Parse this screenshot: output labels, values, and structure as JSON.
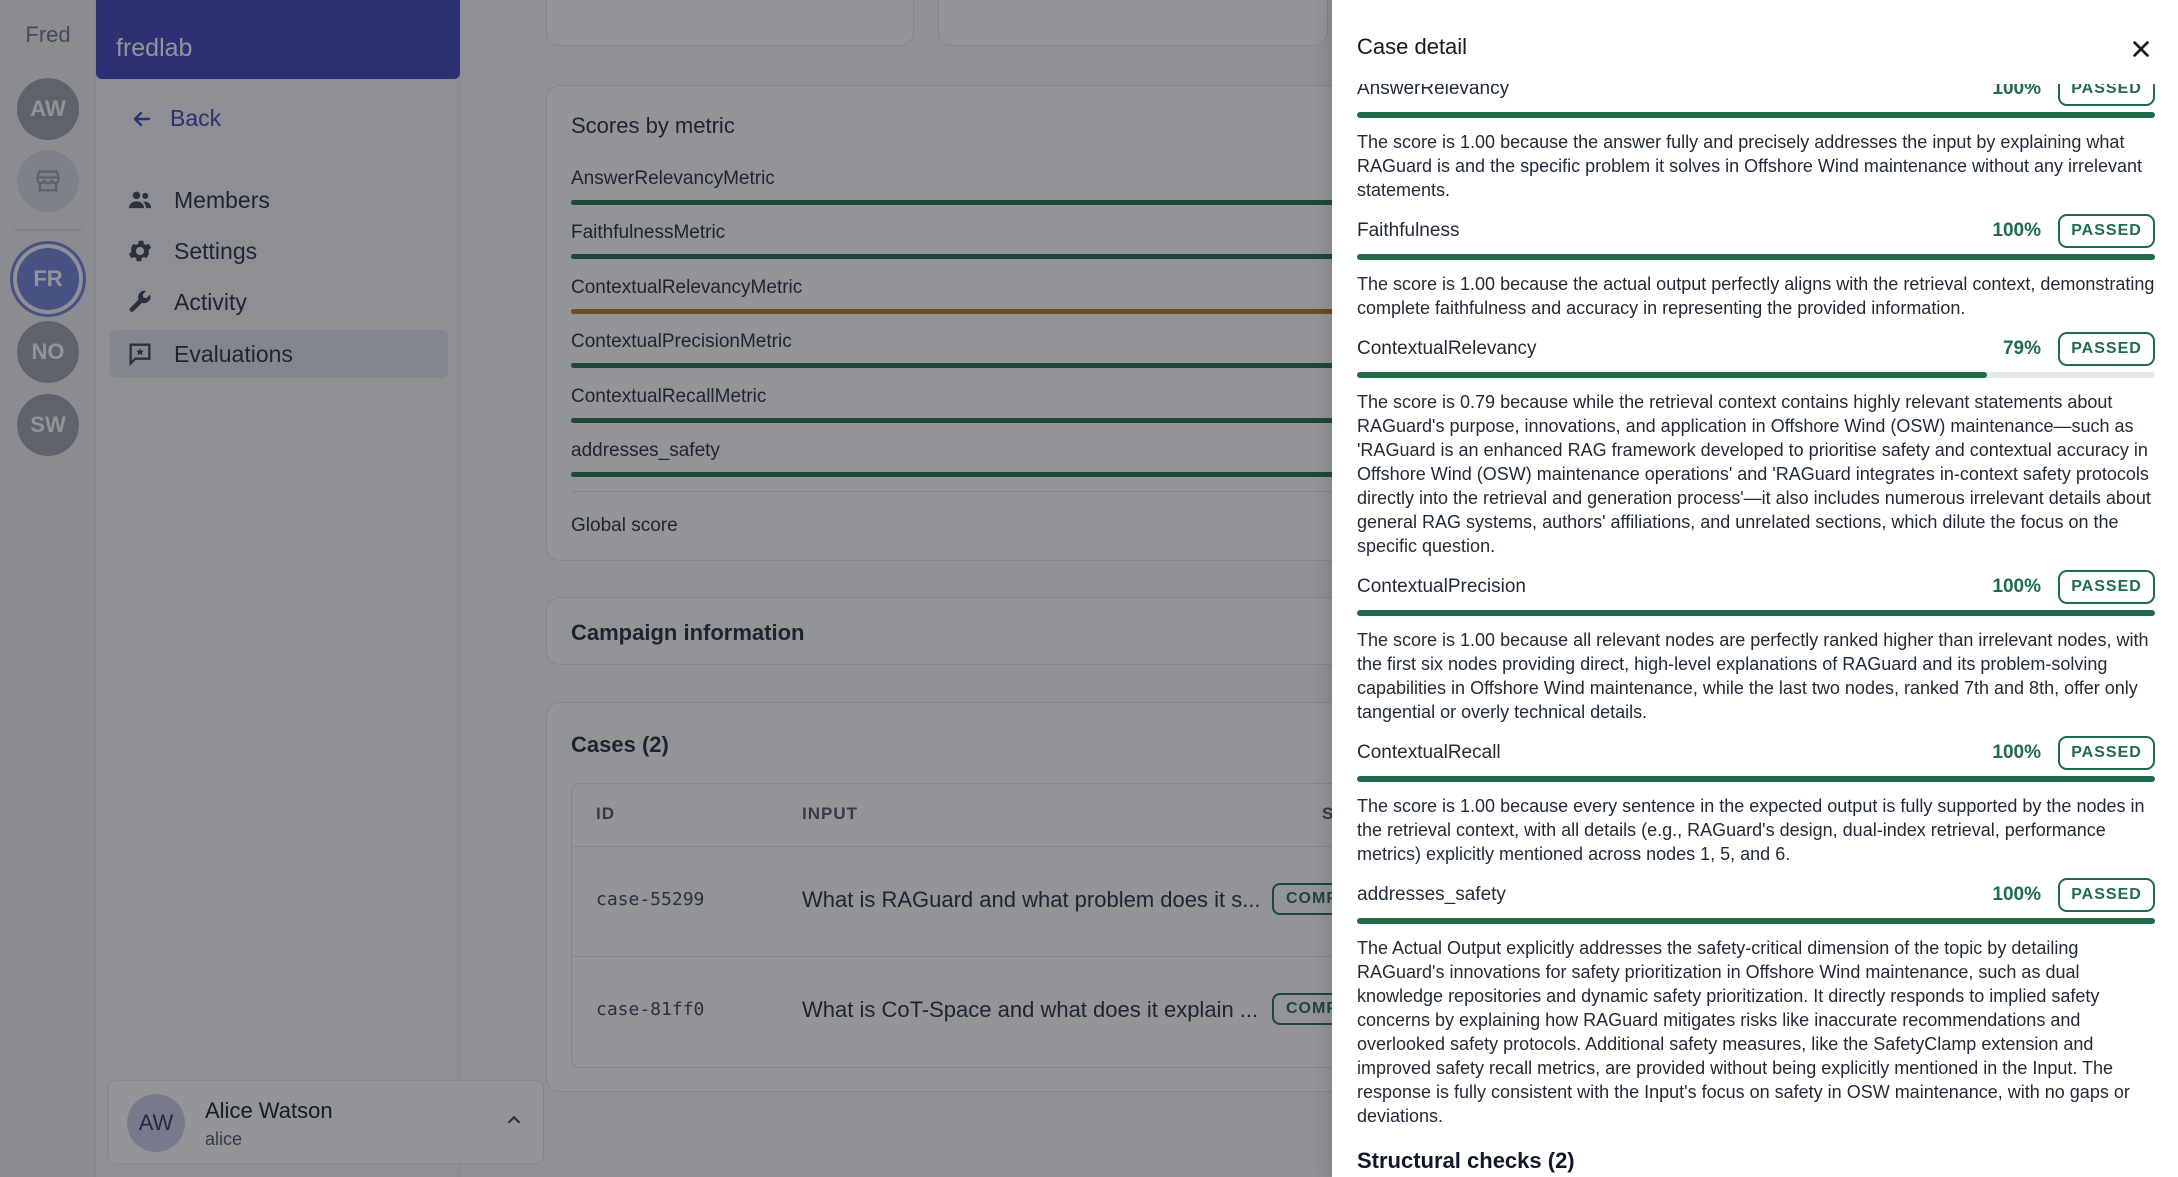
{
  "workspace": {
    "label": "Fred",
    "avatars": [
      {
        "initials": "AW",
        "active": false
      },
      {
        "initials": "",
        "active": false,
        "icon": "store-icon"
      },
      {
        "initials": "FR",
        "active": true
      },
      {
        "initials": "NO",
        "active": false
      },
      {
        "initials": "SW",
        "active": false
      }
    ]
  },
  "sidebar": {
    "org_name": "fredlab",
    "back_label": "Back",
    "items": [
      {
        "label": "Members",
        "icon": "users-icon",
        "active": false
      },
      {
        "label": "Settings",
        "icon": "gear-icon",
        "active": false
      },
      {
        "label": "Activity",
        "icon": "wrench-icon",
        "active": false
      },
      {
        "label": "Evaluations",
        "icon": "chat-star-icon",
        "active": true
      }
    ],
    "user": {
      "initials": "AW",
      "name": "Alice Watson",
      "handle": "alice"
    }
  },
  "scores": {
    "title": "Scores by metric",
    "metrics": [
      {
        "label": "AnswerRelevancyMetric",
        "status": "ok"
      },
      {
        "label": "FaithfulnessMetric",
        "status": "ok"
      },
      {
        "label": "ContextualRelevancyMetric",
        "status": "warn"
      },
      {
        "label": "ContextualPrecisionMetric",
        "status": "ok"
      },
      {
        "label": "ContextualRecallMetric",
        "status": "ok"
      },
      {
        "label": "addresses_safety",
        "status": "ok"
      }
    ],
    "global_label": "Global score"
  },
  "campaign": {
    "title": "Campaign information"
  },
  "cases": {
    "title": "Cases (2)",
    "columns": {
      "id": "ID",
      "input": "INPUT",
      "status": "S"
    },
    "rows": [
      {
        "id": "case-55299",
        "input": "What is RAGuard and what problem does it s...",
        "status": "COMP"
      },
      {
        "id": "case-81ff0",
        "input": "What is CoT-Space and what does it explain ...",
        "status": "COMP"
      }
    ]
  },
  "drawer": {
    "title": "Case detail",
    "metrics": [
      {
        "name": "AnswerRelevancy",
        "pct": "100%",
        "badge": "PASSED",
        "score": 1.0,
        "reason": "The score is 1.00 because the answer fully and precisely addresses the input by explaining what RAGuard is and the specific problem it solves in Offshore Wind maintenance without any irrelevant statements."
      },
      {
        "name": "Faithfulness",
        "pct": "100%",
        "badge": "PASSED",
        "score": 1.0,
        "reason": "The score is 1.00 because the actual output perfectly aligns with the retrieval context, demonstrating complete faithfulness and accuracy in representing the provided information."
      },
      {
        "name": "ContextualRelevancy",
        "pct": "79%",
        "badge": "PASSED",
        "score": 0.79,
        "reason": "The score is 0.79 because while the retrieval context contains highly relevant statements about RAGuard's purpose, innovations, and application in Offshore Wind (OSW) maintenance—such as 'RAGuard is an enhanced RAG framework developed to prioritise safety and contextual accuracy in Offshore Wind (OSW) maintenance operations' and 'RAGuard integrates in-context safety protocols directly into the retrieval and generation process'—it also includes numerous irrelevant details about general RAG systems, authors' affiliations, and unrelated sections, which dilute the focus on the specific question."
      },
      {
        "name": "ContextualPrecision",
        "pct": "100%",
        "badge": "PASSED",
        "score": 1.0,
        "reason": "The score is 1.00 because all relevant nodes are perfectly ranked higher than irrelevant nodes, with the first six nodes providing direct, high-level explanations of RAGuard and its problem-solving capabilities in Offshore Wind maintenance, while the last two nodes, ranked 7th and 8th, offer only tangential or overly technical details."
      },
      {
        "name": "ContextualRecall",
        "pct": "100%",
        "badge": "PASSED",
        "score": 1.0,
        "reason": "The score is 1.00 because every sentence in the expected output is fully supported by the nodes in the retrieval context, with all details (e.g., RAGuard's design, dual-index retrieval, performance metrics) explicitly mentioned across nodes 1, 5, and 6."
      },
      {
        "name": "addresses_safety",
        "pct": "100%",
        "badge": "PASSED",
        "score": 1.0,
        "reason": "The Actual Output explicitly addresses the safety-critical dimension of the topic by detailing RAGuard's innovations for safety prioritization in Offshore Wind maintenance, such as dual knowledge repositories and dynamic safety prioritization. It directly responds to implied safety concerns by explaining how RAGuard mitigates risks like inaccurate recommendations and overlooked safety protocols. Additional safety measures, like the SafetyClamp extension and improved safety recall metrics, are provided without being explicitly mentioned in the Input. The response is fully consistent with the Input's focus on safety in OSW maintenance, with no gaps or deviations."
      }
    ],
    "structural_title": "Structural checks (2)"
  }
}
